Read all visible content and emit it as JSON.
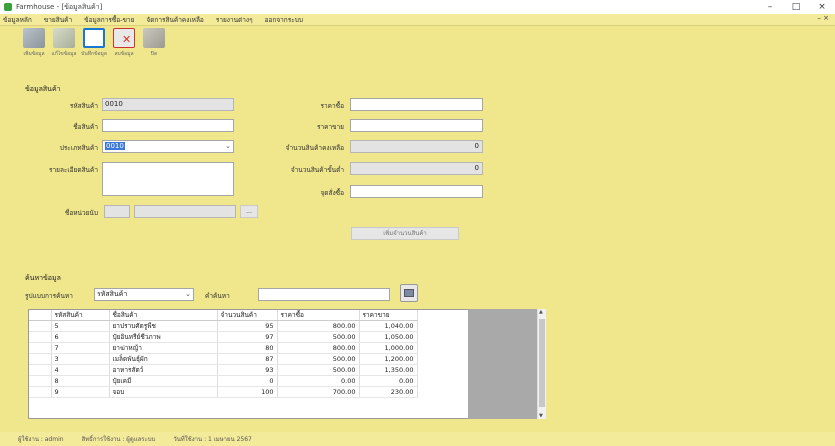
{
  "window": {
    "title": "Farmhouse - [ข้อมูลสินค้า]",
    "minimize": "–",
    "maximize": "□",
    "close": "×"
  },
  "menu": {
    "items": [
      "ข้อมูลหลัก",
      "ขายสินค้า",
      "ข้อมูลการซื้อ-ขาย",
      "จัดการสินค้าคงเหลือ",
      "รายงานต่างๆ",
      "ออกจากระบบ"
    ],
    "mdi_controls": "– ×"
  },
  "toolbar": {
    "add": "เพิ่มข้อมูล",
    "edit": "แก้ไขข้อมูล",
    "save": "บันทึกข้อมูล",
    "delete": "ลบข้อมูล",
    "exit": "ปิด"
  },
  "form": {
    "section_title": "ข้อมูลสินค้า",
    "product_code_label": "รหัสสินค้า",
    "product_code_value": "0010",
    "product_name_label": "ชื่อสินค้า",
    "product_name_value": "",
    "product_type_label": "ประเภทสินค้า",
    "product_type_value": "0010",
    "product_detail_label": "รายละเอียดสินค้า",
    "product_detail_value": "",
    "unit_label": "ชื่อหน่วยนับ",
    "unit_code_value": "",
    "unit_name_value": "",
    "browse_label": "...",
    "cost_label": "ราคาซื้อ",
    "cost_value": "",
    "price_label": "ราคาขาย",
    "price_value": "",
    "stock_label": "จำนวนสินค้าคงเหลือ",
    "stock_value": "0",
    "min_stock_label": "จำนวนสินค้าขั้นต่ำ",
    "min_stock_value": "0",
    "barcode_label": "จุดสั่งซื้อ",
    "barcode_value": "",
    "add_stock_button": "เพิ่มจำนวนสินค้า"
  },
  "search": {
    "section_title": "ค้นหาข้อมูล",
    "type_label": "รูปแบบการค้นหา",
    "type_value": "รหัสสินค้า",
    "term_label": "คำค้นหา",
    "term_value": ""
  },
  "grid": {
    "columns": [
      "รหัสสินค้า",
      "ชื่อสินค้า",
      "จำนวนสินค้า",
      "ราคาซื้อ",
      "ราคาขาย"
    ],
    "rows": [
      [
        "5",
        "ยาปราบศัตรูพืช",
        "95",
        "800.00",
        "1,040.00"
      ],
      [
        "6",
        "ปุ๋ยอินทรีย์ชีวภาพ",
        "97",
        "500.00",
        "1,050.00"
      ],
      [
        "7",
        "ยาฆ่าหญ้า",
        "80",
        "800.00",
        "1,000.00"
      ],
      [
        "3",
        "เมล็ดพันธุ์ผัก",
        "87",
        "500.00",
        "1,200.00"
      ],
      [
        "4",
        "อาหารสัตว์",
        "93",
        "500.00",
        "1,350.00"
      ],
      [
        "8",
        "ปุ๋ยเคมี",
        "0",
        "0.00",
        "0.00"
      ],
      [
        "9",
        "จอบ",
        "100",
        "700.00",
        "230.00"
      ]
    ]
  },
  "status": {
    "user": "ผู้ใช้งาน : admin",
    "role": "สิทธิ์การใช้งาน : ผู้ดูแลระบบ",
    "date": "วันที่ใช้งาน : 1 เมษายน 2567"
  }
}
